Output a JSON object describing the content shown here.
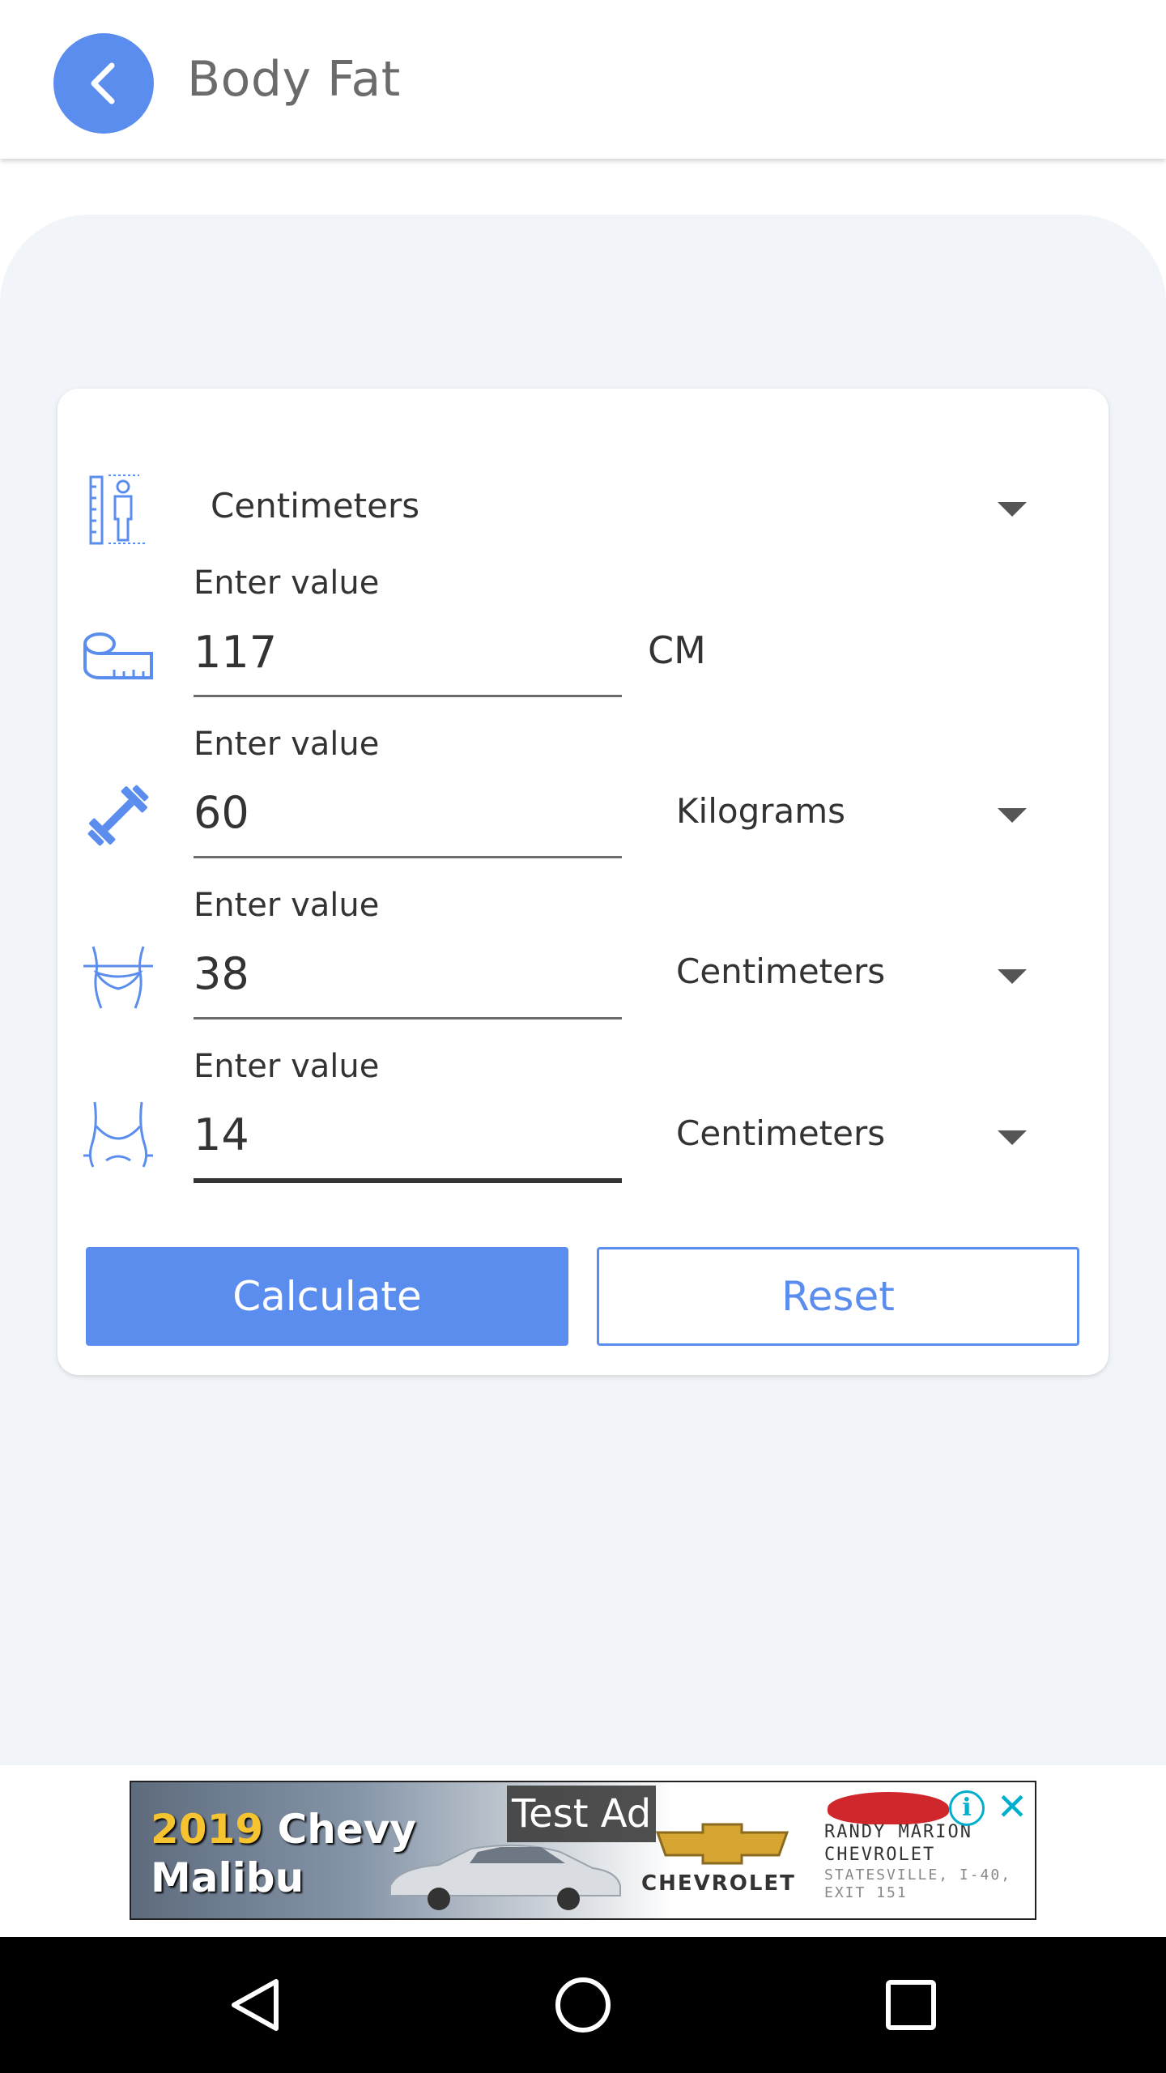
{
  "header": {
    "title": "Body Fat"
  },
  "form": {
    "height_unit_select": "Centimeters",
    "rows": [
      {
        "label": "Enter value",
        "value": "117",
        "unit": "CM"
      },
      {
        "label": "Enter value",
        "value": "60",
        "unit": "Kilograms"
      },
      {
        "label": "Enter value",
        "value": "38",
        "unit": "Centimeters"
      },
      {
        "label": "Enter value",
        "value": "14",
        "unit": "Centimeters"
      }
    ]
  },
  "actions": {
    "calculate_label": "Calculate",
    "reset_label": "Reset"
  },
  "ad": {
    "test_label": "Test Ad",
    "year": "2019",
    "model_line1": "Chevy",
    "model_line2": "Malibu",
    "brand": "CHEVROLET",
    "dealer_line1": "RANDY MARION",
    "dealer_line2": "CHEVROLET",
    "dealer_line3": "STATESVILLE, I-40,",
    "dealer_line4": "EXIT 151"
  },
  "colors": {
    "accent": "#5b8def",
    "background_panel": "#f1f4f8",
    "nav_bar": "#000000"
  },
  "icons": {
    "back": "chevron-left-icon",
    "height": "height-measure-icon",
    "tape": "measuring-tape-icon",
    "weight": "dumbbell-icon",
    "waist": "waist-icon",
    "hip": "hip-icon",
    "nav_back": "triangle-back-icon",
    "nav_home": "circle-home-icon",
    "nav_recents": "square-recents-icon"
  }
}
